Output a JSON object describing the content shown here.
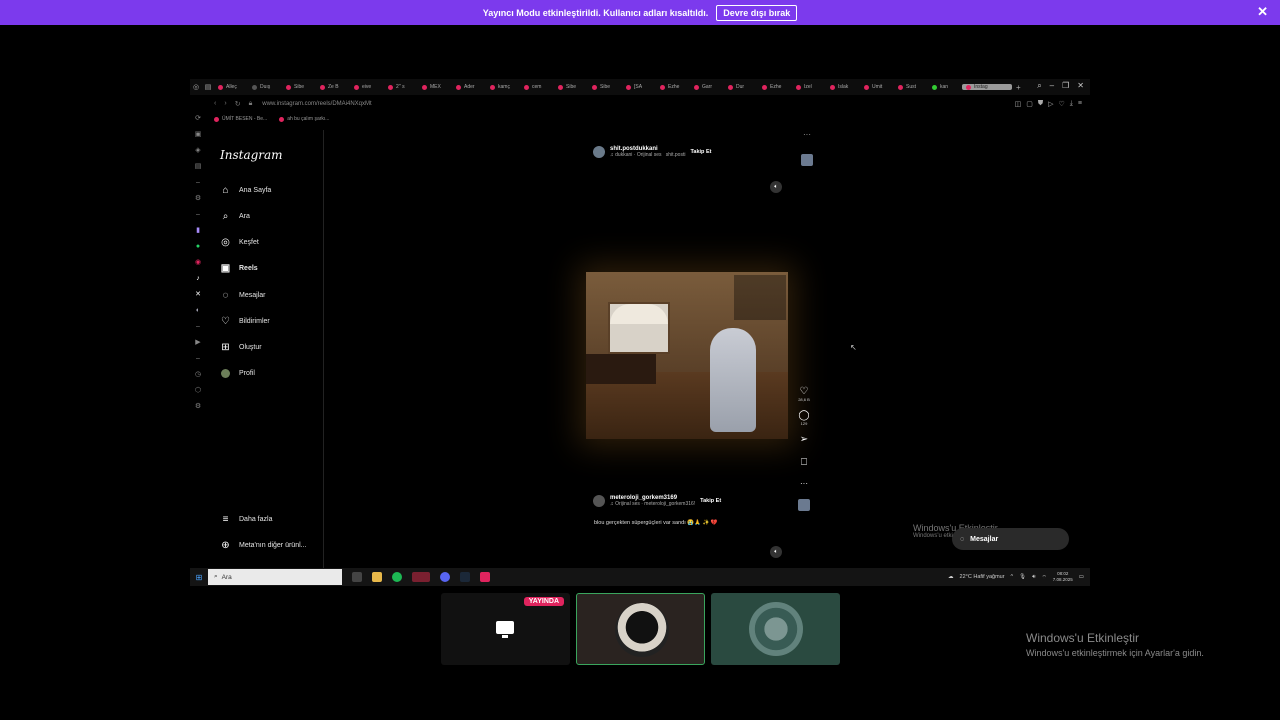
{
  "banner": {
    "message": "Yayıncı Modu etkinleştirildi. Kullanıcı adları kısaltıldı.",
    "button": "Devre dışı bırak"
  },
  "browser": {
    "tabs": [
      "Alleç",
      "Duış",
      "Sibe",
      "Ze B",
      "eive",
      "2'' s",
      "MEX",
      "Ader",
      "kamç",
      "cem",
      "Sibe",
      "Sibe",
      "[SA",
      "Ezhe",
      "Garr",
      "Dur",
      "Ezhe",
      "Izel",
      "Islak",
      "Ümit",
      "Sust",
      "kan",
      "Instag"
    ],
    "url": "www.instagram.com/reels/DMAi4NXqxMt",
    "bookmarks": [
      "ÜMİT BESEN - Be...",
      "ah bu çalım şarkı..."
    ]
  },
  "instagram": {
    "logo": "Instagram",
    "nav": [
      "Ana Sayfa",
      "Ara",
      "Keşfet",
      "Reels",
      "Mesajlar",
      "Bildirimler",
      "Oluştur",
      "Profil"
    ],
    "more": "Daha fazla",
    "meta": "Meta'nın diğer ürünl..."
  },
  "reel_top": {
    "username": "shit.postdukkani",
    "audio": "♫ dukkani · Orijinal ses",
    "audio2": "shit.posti",
    "follow": "Takip Et"
  },
  "reel_main": {
    "likes": "28,6 B",
    "comments": "129",
    "username": "meteroloji_gorkem3169",
    "audio": "♫ Orijinal ses · meteroloji_gorkem316!",
    "follow": "Takip Et",
    "caption": "blou gerçekten süpergüçleri var sandı 😭🙏 ✨ 💔"
  },
  "taskbar": {
    "search": "Ara",
    "weather": "22°C  Hafif yağmur",
    "time": "08:02",
    "date": "7.08.2025"
  },
  "messages_pill": "Mesajlar",
  "watermark_small": {
    "l1": "Windows'u Etkinleştir",
    "l2": "Windows'u etki... Ayarlar..."
  },
  "tiles": {
    "live_badge": "YAYINDA"
  },
  "watermark": {
    "line1": "Windows'u Etkinleştir",
    "line2": "Windows'u etkinleştirmek için Ayarlar'a gidin."
  }
}
